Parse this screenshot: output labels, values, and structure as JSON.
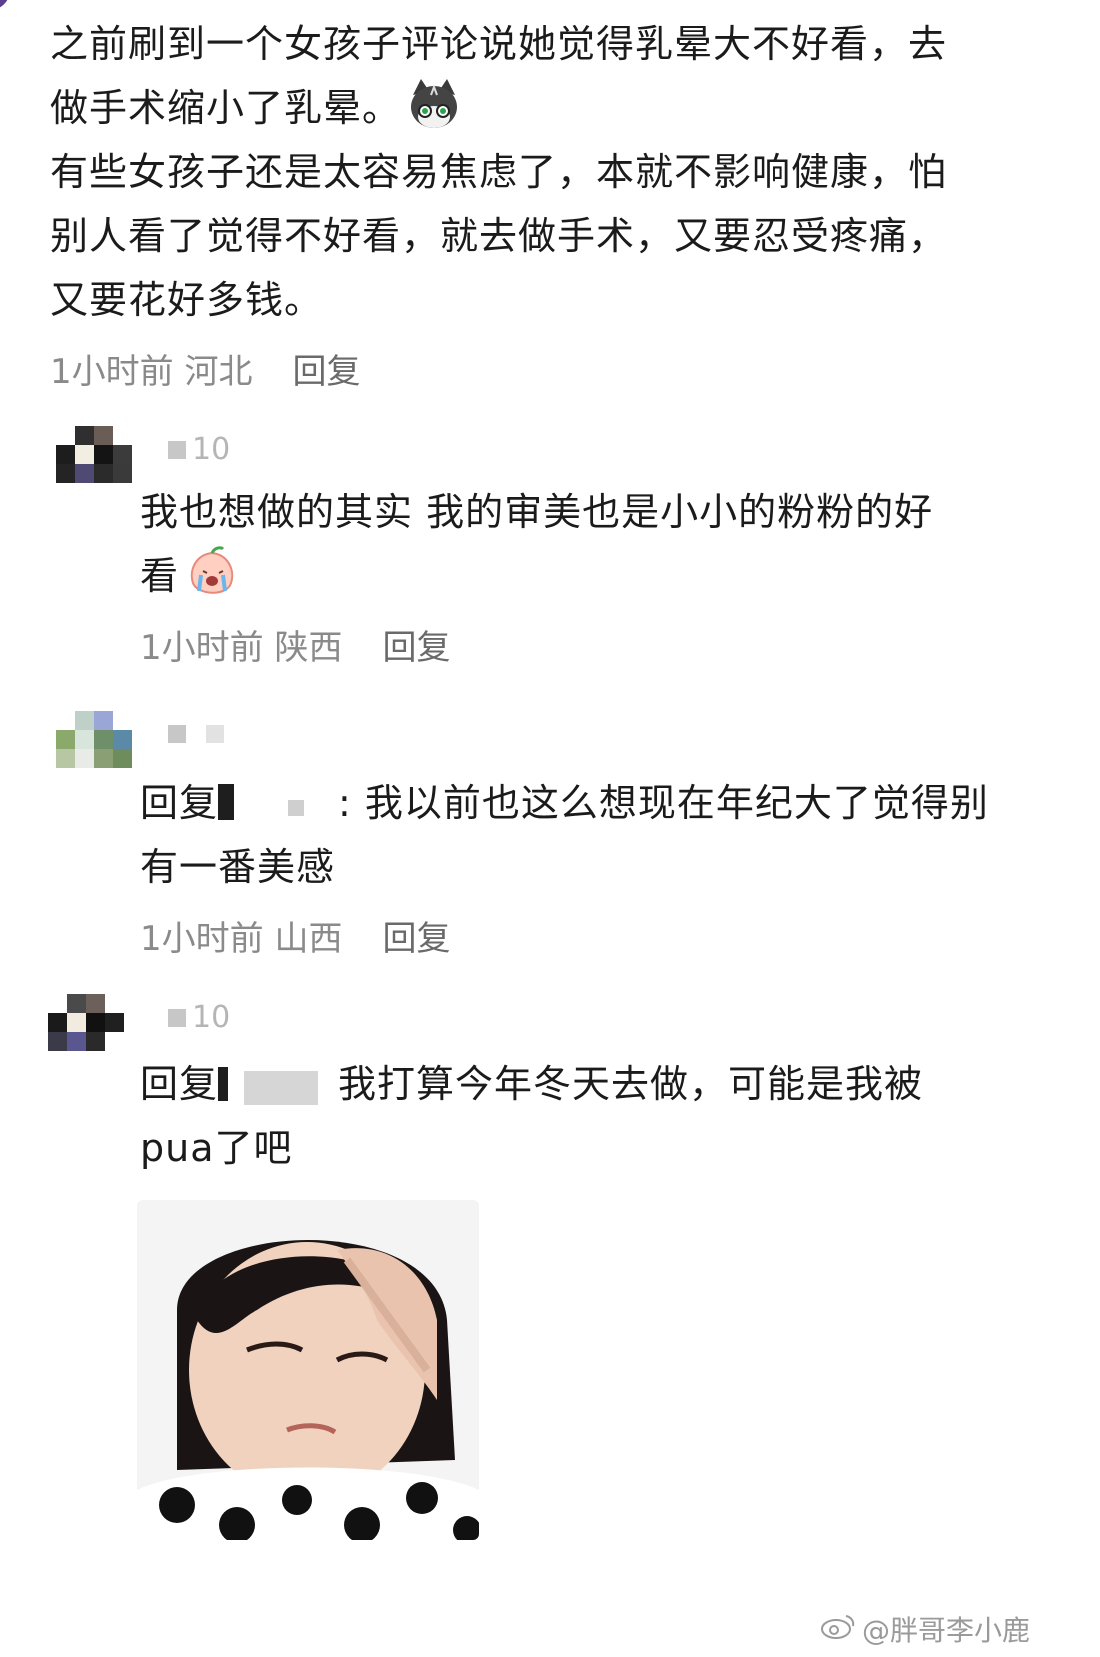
{
  "top_comment": {
    "line1": "之前刷到一个女孩子评论说她觉得乳晕大不好看，去",
    "line2": "做手术缩小了乳晕。",
    "line3": "有些女孩子还是太容易焦虑了，本就不影响健康，怕",
    "line4": "别人看了觉得不好看，就去做手术，又要忍受疼痛，",
    "line5": "又要花好多钱。",
    "time": "1小时前",
    "location": "河北",
    "reply": "回复",
    "emoji_icon": "cat-emoji-icon"
  },
  "replies": [
    {
      "name_suffix": "10",
      "line1": "我也想做的其实 我的审美也是小小的粉粉的好",
      "line2": "看",
      "time": "1小时前",
      "location": "陕西",
      "reply": "回复",
      "emoji_icon": "crying-peach-emoji-icon"
    },
    {
      "prefix": "回复",
      "line1": ": 我以前也这么想现在年纪大了觉得别",
      "line2": "有一番美感",
      "time": "1小时前",
      "location": "山西",
      "reply": "回复"
    },
    {
      "name_suffix": "10",
      "prefix": "回复",
      "line1": "我打算今年冬天去做，可能是我被",
      "line2": "pua了吧"
    }
  ],
  "watermark": "@胖哥李小鹿"
}
